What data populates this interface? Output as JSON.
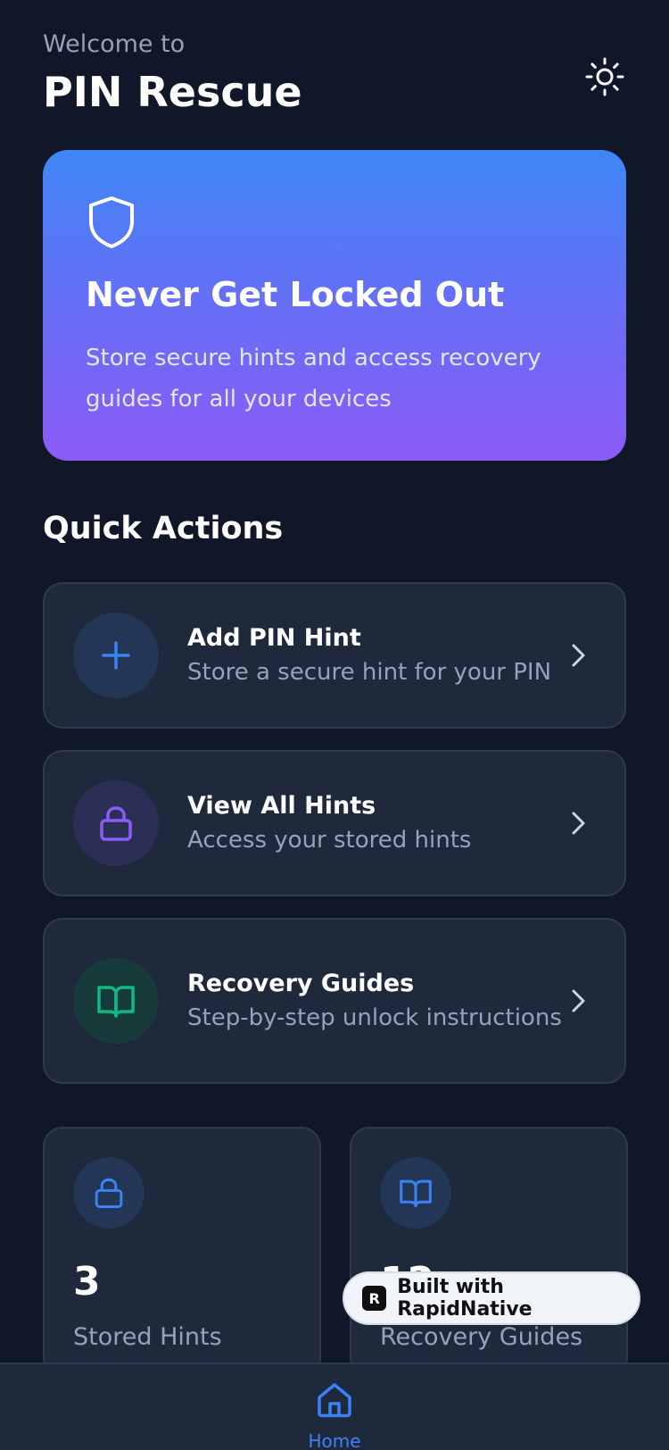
{
  "header": {
    "welcome": "Welcome to",
    "title": "PIN Rescue"
  },
  "hero": {
    "title": "Never Get Locked Out",
    "description": "Store secure hints and access recovery guides for all your devices"
  },
  "quick_actions": {
    "title": "Quick Actions",
    "items": [
      {
        "title": "Add PIN Hint",
        "subtitle": "Store a secure hint for your PIN",
        "icon": "plus-icon"
      },
      {
        "title": "View All Hints",
        "subtitle": "Access your stored hints",
        "icon": "lock-icon"
      },
      {
        "title": "Recovery Guides",
        "subtitle": "Step-by-step unlock instructions",
        "icon": "book-icon"
      }
    ]
  },
  "stats": [
    {
      "value": "3",
      "label": "Stored Hints",
      "icon": "lock-icon"
    },
    {
      "value": "12",
      "label": "Recovery Guides",
      "icon": "book-icon"
    }
  ],
  "badge": {
    "text": "Built with RapidNative",
    "logo": "R"
  },
  "nav": {
    "home_label": "Home"
  },
  "colors": {
    "background": "#0f1729",
    "card": "#1e293b",
    "accent_blue": "#3b82f6",
    "accent_purple": "#8b5cf6",
    "accent_green": "#10b981"
  }
}
